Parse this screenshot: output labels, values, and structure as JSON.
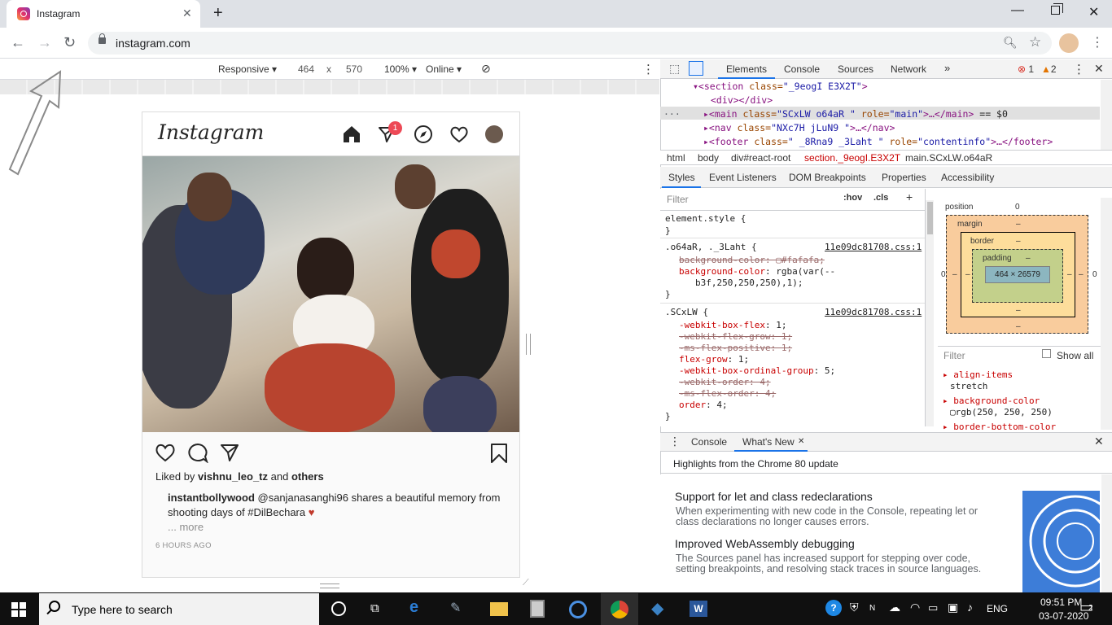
{
  "browser": {
    "tab_title": "Instagram",
    "url": "instagram.com",
    "new_tab": "+",
    "close_tab": "✕"
  },
  "device_toolbar": {
    "device": "Responsive ▾",
    "width": "464",
    "times": "x",
    "height": "570",
    "zoom": "100% ▾",
    "network": "Online ▾"
  },
  "instagram": {
    "logo": "Instagram",
    "notification_count": "1",
    "liked_prefix": "Liked by ",
    "liked_user": "vishnu_leo_tz",
    "liked_and": " and ",
    "liked_others": "others",
    "caption_user": "instantbollywood",
    "caption_text": " @sanjanasanghi96 shares a beautiful memory from shooting days of #DilBechara ",
    "caption_emoji": "♥",
    "more": "... more",
    "timestamp": "6 HOURS AGO"
  },
  "devtools": {
    "tabs": [
      "Elements",
      "Console",
      "Sources",
      "Network"
    ],
    "more_tabs": "»",
    "errors": "1",
    "warnings": "2",
    "dom": {
      "line1_tag": "▾<section ",
      "line1_attr": "class=",
      "line1_val": "\"_9eogI E3X2T\"",
      "line1_end": ">",
      "line2": "<div></div>",
      "line3_prefix": "▸<main ",
      "line3_attr1": "class=",
      "line3_val1": "\"SCxLW  o64aR \"",
      "line3_attr2": " role=",
      "line3_val2": "\"main\"",
      "line3_end": ">…</main>",
      "line3_eq": " == $0",
      "line4_prefix": "▸<nav ",
      "line4_attr": "class=",
      "line4_val": "\"NXc7H jLuN9  \"",
      "line4_end": ">…</nav>",
      "line5_prefix": "▸<footer ",
      "line5_attr1": "class=",
      "line5_val1": "\" _8Rna9  _3Laht \"",
      "line5_attr2": " role=",
      "line5_val2": "\"contentinfo\"",
      "line5_end": ">…</footer>"
    },
    "breadcrumbs": [
      "html",
      "body",
      "div#react-root",
      "section._9eogI.E3X2T",
      "main.SCxLW.o64aR"
    ],
    "styles_tabs": [
      "Styles",
      "Event Listeners",
      "DOM Breakpoints",
      "Properties",
      "Accessibility"
    ],
    "filter_placeholder": "Filter",
    "hov": ":hov",
    "cls": ".cls",
    "add": "+",
    "rules": {
      "element_style": "element.style {",
      "close": "}",
      "rule1_selector": ".o64aR, ._3Laht {",
      "rule1_source": "11e09dc81708.css:1",
      "rule1_p1": "background-color: ",
      "rule1_v1": "#fafafa;",
      "rule1_p2": "background-color",
      "rule1_v2": ": rgba(var(--",
      "rule1_v2b": "b3f,250,250,250),1);",
      "rule2_selector": ".SCxLW {",
      "rule2_source": "11e09dc81708.css:1",
      "rule2_lines": [
        {
          "p": "-webkit-box-flex",
          "v": ": 1;",
          "s": false
        },
        {
          "p": "-webkit-flex-grow",
          "v": ": 1;",
          "s": true
        },
        {
          "p": "-ms-flex-positive",
          "v": ": 1;",
          "s": true
        },
        {
          "p": "flex-grow",
          "v": ": 1;",
          "s": false
        },
        {
          "p": "-webkit-box-ordinal-group",
          "v": ": 5;",
          "s": false
        },
        {
          "p": "-webkit-order",
          "v": ": 4;",
          "s": true
        },
        {
          "p": "-ms-flex-order",
          "v": ": 4;",
          "s": true
        },
        {
          "p": "order",
          "v": ": 4;",
          "s": false
        }
      ]
    },
    "box_model": {
      "position_label": "position",
      "position_val": "0",
      "margin_label": "margin",
      "border_label": "border",
      "padding_label": "padding",
      "dash": "–",
      "zero": "0",
      "content": "464 × 26579"
    },
    "computed": {
      "filter": "Filter",
      "show_all": "Show all",
      "p1": "align-items",
      "v1": "stretch",
      "p2": "background-color",
      "v2": "rgb(250, 250, 250)",
      "p3": "border-bottom-color"
    },
    "drawer": {
      "tabs": [
        "Console",
        "What's New"
      ],
      "close_x": "✕",
      "heading": "Highlights from the Chrome 80 update",
      "item1_title": "Support for let and class redeclarations",
      "item1_text": "When experimenting with new code in the Console, repeating let or class declarations no longer causes errors.",
      "item2_title": "Improved WebAssembly debugging",
      "item2_text": "The Sources panel has increased support for stepping over code, setting breakpoints, and resolving stack traces in source languages."
    }
  },
  "taskbar": {
    "search_placeholder": "Type here to search",
    "lang": "ENG",
    "time": "09:51 PM",
    "date": "03-07-2020",
    "notifications": "2"
  },
  "colors": {
    "accent": "#1a73e8",
    "instagram_badge": "#ed4956",
    "taskbar": "#101010"
  }
}
